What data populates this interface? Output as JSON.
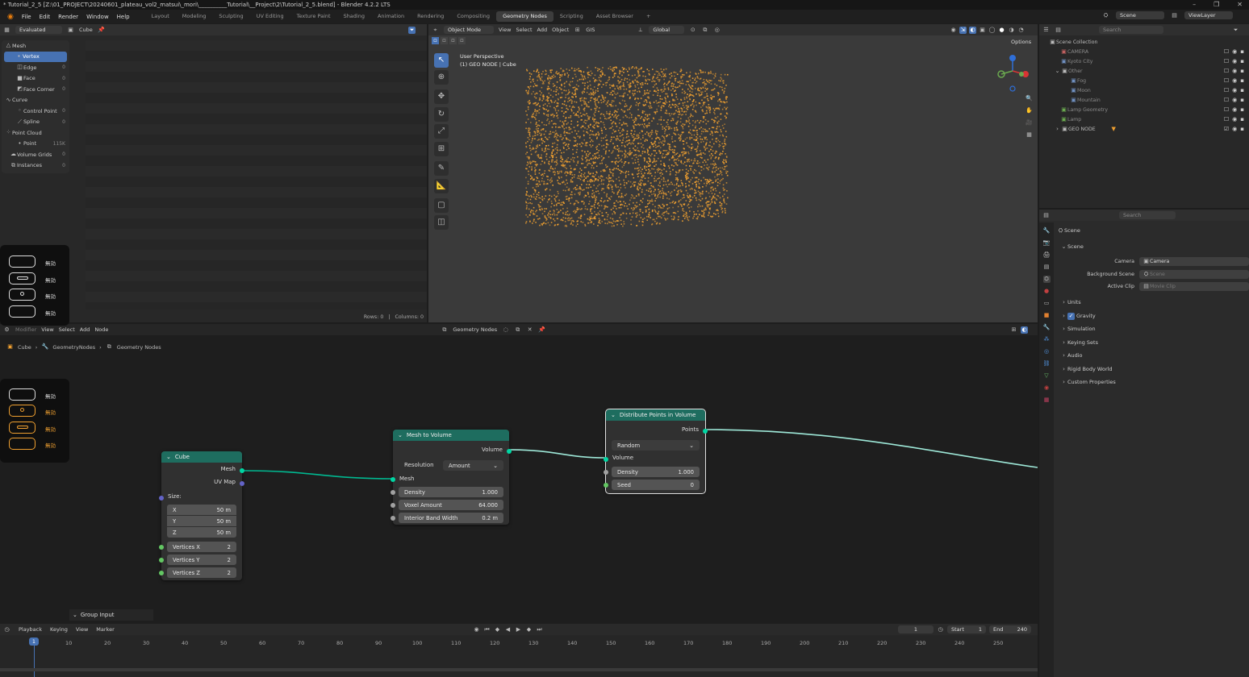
{
  "window": {
    "title": "* Tutorial_2_5 [Z:\\01_PROJECT\\20240601_plateau_vol2_matsui\\_mori\\__________Tutorial\\__Project\\2\\Tutorial_2_5.blend] - Blender 4.2.2 LTS",
    "controls": [
      "–",
      "❐",
      "✕"
    ]
  },
  "menubar": {
    "menus": [
      "File",
      "Edit",
      "Render",
      "Window",
      "Help"
    ],
    "workspaces": [
      "Layout",
      "Modeling",
      "Sculpting",
      "UV Editing",
      "Texture Paint",
      "Shading",
      "Animation",
      "Rendering",
      "Compositing",
      "Geometry Nodes",
      "Scripting",
      "Asset Browser"
    ],
    "active_workspace": "Geometry Nodes",
    "add_tab": "+",
    "scene_label": "Scene",
    "viewlayer_label": "ViewLayer"
  },
  "spreadsheet": {
    "mode": "Evaluated",
    "object": "Cube",
    "tree": [
      {
        "label": "Mesh",
        "count": "",
        "indent": 0,
        "sel": false
      },
      {
        "label": "Vertex",
        "count": "",
        "indent": 1,
        "sel": true
      },
      {
        "label": "Edge",
        "count": "0",
        "indent": 1,
        "sel": false
      },
      {
        "label": "Face",
        "count": "0",
        "indent": 1,
        "sel": false
      },
      {
        "label": "Face Corner",
        "count": "0",
        "indent": 1,
        "sel": false
      },
      {
        "label": "Curve",
        "count": "",
        "indent": 0,
        "sel": false
      },
      {
        "label": "Control Point",
        "count": "0",
        "indent": 1,
        "sel": false
      },
      {
        "label": "Spline",
        "count": "0",
        "indent": 1,
        "sel": false
      },
      {
        "label": "Point Cloud",
        "count": "",
        "indent": 0,
        "sel": false
      },
      {
        "label": "Point",
        "count": "115K",
        "indent": 1,
        "sel": false
      },
      {
        "label": "Volume Grids",
        "count": "0",
        "indent": 0,
        "sel": false
      },
      {
        "label": "Instances",
        "count": "0",
        "indent": 0,
        "sel": false
      }
    ],
    "rows": "Rows: 0",
    "columns": "Columns: 0"
  },
  "viewport": {
    "mode": "Object Mode",
    "menus": [
      "View",
      "Select",
      "Add",
      "Object"
    ],
    "gis": "GIS",
    "orientation": "Global",
    "perspective": "User Perspective",
    "context": "(1) GEO NODE | Cube",
    "options": "Options",
    "point_color": "#f0a030"
  },
  "outliner": {
    "search_placeholder": "Search",
    "items": [
      {
        "label": "Scene Collection",
        "indent": 0,
        "dim": false
      },
      {
        "label": "CAMERA",
        "indent": 1,
        "dim": true
      },
      {
        "label": "Kyoto City",
        "indent": 1,
        "dim": true
      },
      {
        "label": "Other",
        "indent": 1,
        "dim": true
      },
      {
        "label": "Fog",
        "indent": 2,
        "dim": true
      },
      {
        "label": "Moon",
        "indent": 2,
        "dim": true
      },
      {
        "label": "Mountain",
        "indent": 2,
        "dim": true
      },
      {
        "label": "Lamp Geometry",
        "indent": 1,
        "dim": true
      },
      {
        "label": "Lamp",
        "indent": 1,
        "dim": true
      },
      {
        "label": "GEO NODE",
        "indent": 1,
        "dim": false
      }
    ]
  },
  "properties": {
    "search_placeholder": "Search",
    "breadcrumb": "Scene",
    "section": "Scene",
    "camera_label": "Camera",
    "camera_value": "Camera",
    "bg_scene_label": "Background Scene",
    "bg_scene_placeholder": "Scene",
    "active_clip_label": "Active Clip",
    "active_clip_placeholder": "Movie Clip",
    "subsections": [
      "Units",
      "Gravity",
      "Simulation",
      "Keying Sets",
      "Audio",
      "Rigid Body World",
      "Custom Properties"
    ]
  },
  "node_editor": {
    "header_menus": [
      "Modifier",
      "View",
      "Select",
      "Add",
      "Node"
    ],
    "tree_name": "Geometry Nodes",
    "breadcrumb": [
      "Cube",
      "GeometryNodes",
      "Geometry Nodes"
    ],
    "group_input_label": "Group Input",
    "nodes": {
      "cube": {
        "title": "Cube",
        "out_mesh": "Mesh",
        "out_uv": "UV Map",
        "size_label": "Size:",
        "x_label": "X",
        "x_value": "50 m",
        "y_label": "Y",
        "y_value": "50 m",
        "z_label": "Z",
        "z_value": "50 m",
        "vx_label": "Vertices X",
        "vx_value": "2",
        "vy_label": "Vertices Y",
        "vy_value": "2",
        "vz_label": "Vertices Z",
        "vz_value": "2"
      },
      "mesh_to_volume": {
        "title": "Mesh to Volume",
        "out_volume": "Volume",
        "resolution_label": "Resolution",
        "resolution_value": "Amount",
        "in_mesh": "Mesh",
        "density_label": "Density",
        "density_value": "1.000",
        "voxel_label": "Voxel Amount",
        "voxel_value": "64.000",
        "band_label": "Interior Band Width",
        "band_value": "0.2 m"
      },
      "distribute": {
        "title": "Distribute Points in Volume",
        "out_points": "Points",
        "mode_value": "Random",
        "in_volume": "Volume",
        "density_label": "Density",
        "density_value": "1.000",
        "seed_label": "Seed",
        "seed_value": "0"
      }
    }
  },
  "key_overlay": {
    "top": [
      "無効",
      "無効",
      "無効",
      "無効"
    ],
    "bottom": [
      "無効",
      "無効",
      "無効",
      "無効"
    ]
  },
  "timeline": {
    "menus": [
      "Playback",
      "Keying",
      "View",
      "Marker"
    ],
    "current_frame": "1",
    "start_label": "Start",
    "start_value": "1",
    "end_label": "End",
    "end_value": "240",
    "ticks": [
      "1",
      "10",
      "20",
      "30",
      "40",
      "50",
      "60",
      "70",
      "80",
      "90",
      "100",
      "110",
      "120",
      "130",
      "140",
      "150",
      "160",
      "170",
      "180",
      "190",
      "200",
      "210",
      "220",
      "230",
      "240",
      "250"
    ]
  }
}
